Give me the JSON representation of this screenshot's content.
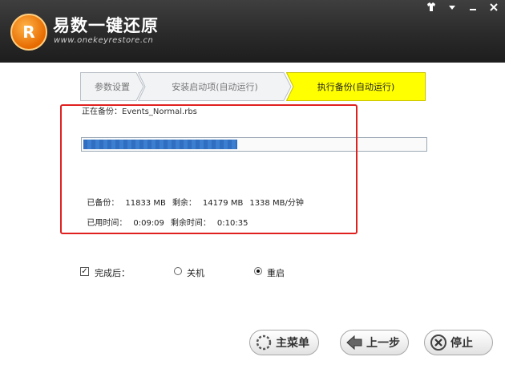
{
  "header": {
    "title": "易数一键还原",
    "url": "www.onekeyrestore.cn",
    "controls": [
      "skin-icon",
      "menu-icon",
      "close-icon"
    ]
  },
  "steps": [
    {
      "label": "参数设置",
      "state": "done"
    },
    {
      "label": "安装启动项(自动运行)",
      "state": "done"
    },
    {
      "label": "执行备份(自动运行)",
      "state": "active"
    }
  ],
  "progress": {
    "current_file": "正在备份：Events_Normal.rbs",
    "fraction": 0.45
  },
  "stats": {
    "backed_label": "已备份：",
    "backed_value": "11833 MB",
    "remaining_label": "剩余：",
    "remaining_value": "14179 MB",
    "speed": "1338 MB/分钟",
    "elapsed_label": "已用时间：",
    "elapsed_value": "0:09:09",
    "left_label": "剩余时间：",
    "left_value": "0:10:35"
  },
  "options": {
    "after_checked": true,
    "after_label": "完成后：",
    "shutdown_label": "关机",
    "reboot_label": "重启",
    "selected": "reboot"
  },
  "buttons": {
    "main_menu": "主菜单",
    "prev_step": "上一步",
    "stop": "停止"
  },
  "colors": {
    "step_active": "#ffff00",
    "progress": "#2f6ec0",
    "highlight": "#e02020"
  }
}
